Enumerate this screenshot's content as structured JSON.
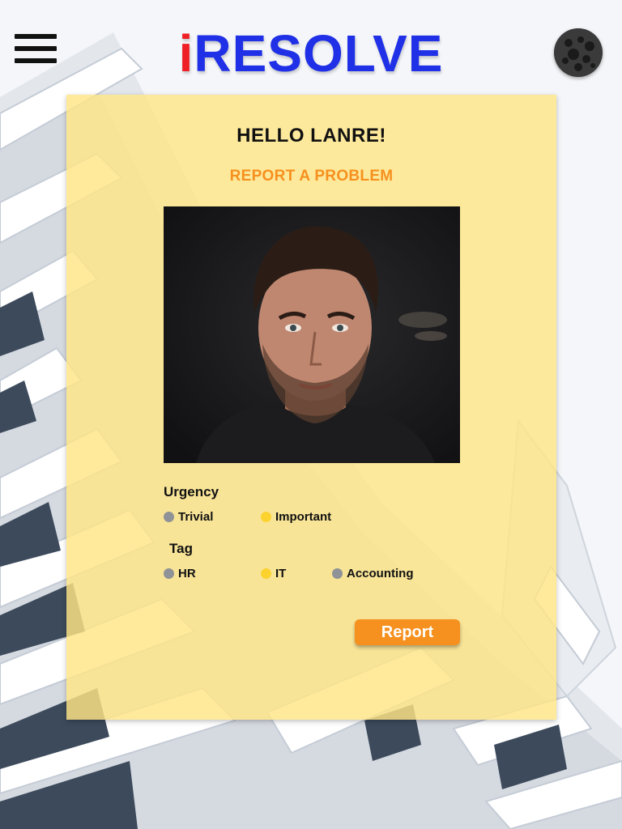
{
  "app": {
    "logo_prefix": "i",
    "logo_rest": "RESOLVE",
    "menu_icon": "hamburger-menu-icon",
    "avatar_icon": "profile-avatar"
  },
  "panel": {
    "greeting": "HELLO LANRE!",
    "subtitle": "REPORT A PROBLEM",
    "photo": "user-portrait-photo"
  },
  "urgency": {
    "label": "Urgency",
    "options": [
      {
        "label": "Trivial",
        "selected": false
      },
      {
        "label": "Important",
        "selected": true
      }
    ]
  },
  "tag": {
    "label": "Tag",
    "options": [
      {
        "label": "HR",
        "selected": false
      },
      {
        "label": "IT",
        "selected": true
      },
      {
        "label": "Accounting",
        "selected": false
      }
    ]
  },
  "actions": {
    "report_label": "Report"
  },
  "colors": {
    "logo_red": "#ee1f25",
    "logo_blue": "#1f30e6",
    "panel_yellow": "#ffe586",
    "accent_orange": "#f6901e",
    "radio_selected": "#fcd22f",
    "radio_unselected": "#8f9296"
  }
}
